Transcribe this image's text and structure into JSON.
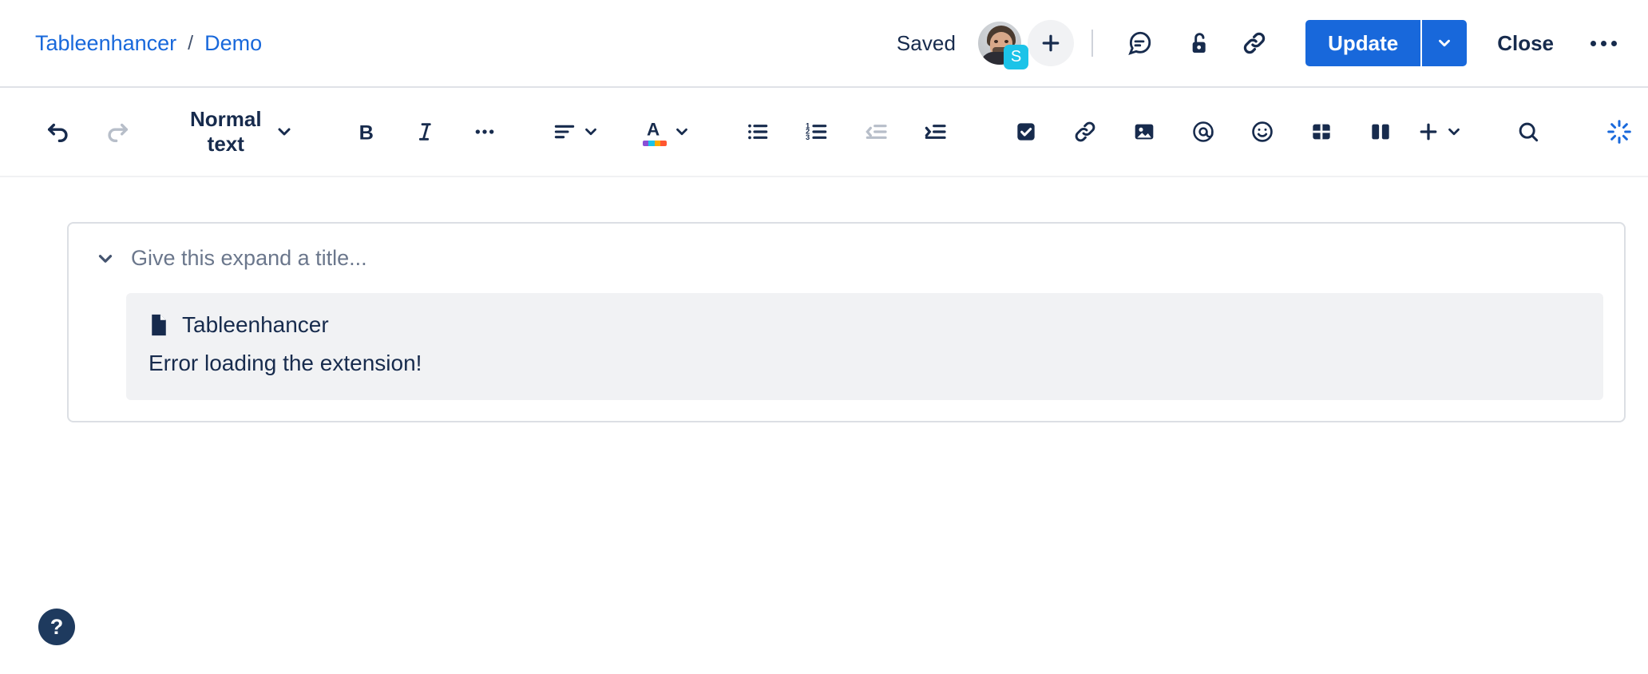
{
  "header": {
    "breadcrumb": {
      "space": "Tableenhancer",
      "separator": "/",
      "page": "Demo"
    },
    "save_status": "Saved",
    "avatar_badge": "S",
    "add_person_icon": "plus-icon",
    "comment_icon": "comment-icon",
    "restrictions_icon": "unlock-icon",
    "copy_link_icon": "link-icon",
    "update_label": "Update",
    "update_caret_icon": "chevron-down-icon",
    "close_label": "Close",
    "more_icon": "more-horizontal-icon",
    "accent_color": "#1868db",
    "badge_color": "#1cc3e8",
    "text_color": "#172b4d",
    "link_color": "#1868db"
  },
  "toolbar": {
    "undo": {
      "name": "undo-icon",
      "enabled": true
    },
    "redo": {
      "name": "redo-icon",
      "enabled": false
    },
    "text_style": {
      "label": "Normal text",
      "caret": "chevron-down-icon"
    },
    "bold": {
      "label": "B",
      "name": "bold-icon"
    },
    "italic": {
      "label": "I",
      "name": "italic-icon"
    },
    "more_formatting": {
      "name": "more-formatting-icon"
    },
    "text_align": {
      "name": "text-align-icon",
      "caret": "chevron-down-icon"
    },
    "text_color": {
      "label": "A",
      "name": "text-color-icon",
      "caret": "chevron-down-icon",
      "swatch": [
        "#8a4fd6",
        "#1cc3e8",
        "#ffab00",
        "#ff5630"
      ]
    },
    "bullet_list": {
      "name": "bullet-list-icon"
    },
    "numbered_list": {
      "name": "numbered-list-icon"
    },
    "outdent": {
      "name": "outdent-icon",
      "enabled": false
    },
    "indent": {
      "name": "indent-icon",
      "enabled": true
    },
    "task_list": {
      "name": "checkbox-icon"
    },
    "link": {
      "name": "link-icon"
    },
    "image": {
      "name": "image-icon"
    },
    "mention": {
      "name": "mention-icon"
    },
    "emoji": {
      "name": "emoji-icon"
    },
    "table": {
      "name": "table-icon"
    },
    "layout": {
      "name": "layout-columns-icon"
    },
    "insert": {
      "name": "plus-icon",
      "caret": "chevron-down-icon"
    },
    "find_replace": {
      "name": "search-icon"
    },
    "ai_assistant": {
      "name": "ai-sparkle-icon",
      "color": "#1868db"
    }
  },
  "content": {
    "expand": {
      "chevron_icon": "chevron-down-icon",
      "title_placeholder": "Give this expand a title...",
      "extension": {
        "icon": "page-document-icon",
        "title": "Tableenhancer",
        "message": "Error loading the extension!",
        "background": "#f1f2f4"
      }
    }
  },
  "help": {
    "label": "?",
    "icon": "question-circle-icon"
  }
}
